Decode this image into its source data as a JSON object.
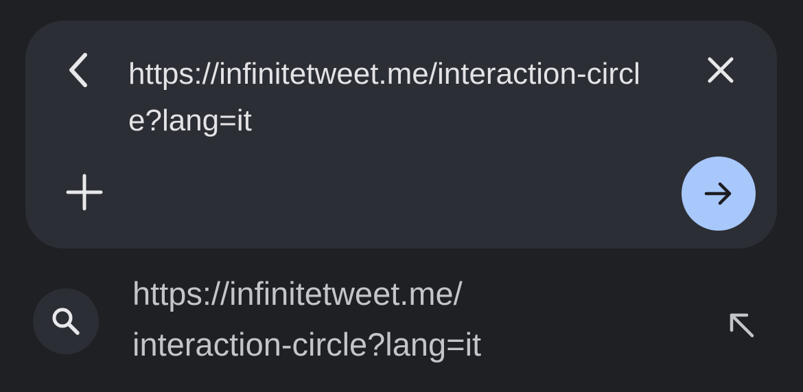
{
  "omnibox": {
    "url_line1": "https://infinitetweet.me/interaction-",
    "url_line2": "circle?lang=it",
    "back_icon": "chevron-left-icon",
    "clear_icon": "close-icon",
    "add_icon": "plus-icon",
    "go_icon": "arrow-right-icon",
    "go_color": "#a8c7fa"
  },
  "suggestion": {
    "text_line1": "https://infinitetweet.me/",
    "text_line2": "interaction-circle?lang=it",
    "icon": "search-icon",
    "fill_icon": "arrow-up-left-icon"
  },
  "colors": {
    "background": "#1f2024",
    "surface": "#2c2e35",
    "accent": "#a8c7fa"
  }
}
